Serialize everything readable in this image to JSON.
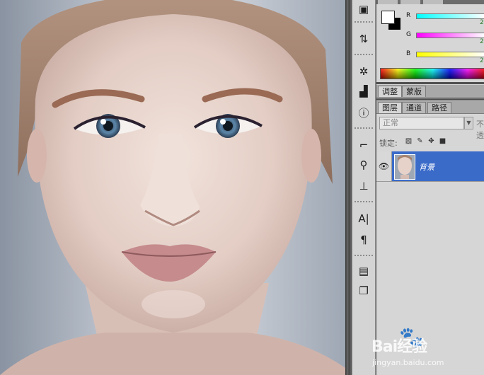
{
  "canvas": {
    "image_name": "portrait-photo"
  },
  "dock": {
    "icons": [
      "navigator-icon",
      "history-icon",
      "actions-icon",
      "histogram-icon",
      "info-icon",
      "brushes-icon",
      "clone-source-icon",
      "tool-presets-icon",
      "character-icon",
      "paragraph-icon",
      "notes-icon",
      "layer-comps-icon"
    ]
  },
  "color_panel": {
    "channels": [
      {
        "label": "R",
        "value": "2"
      },
      {
        "label": "G",
        "value": "2"
      },
      {
        "label": "B",
        "value": "2"
      }
    ],
    "foreground": "#ffffff",
    "background": "#000000"
  },
  "adjust_tabs": [
    {
      "label": "调整",
      "active": true
    },
    {
      "label": "蒙版",
      "active": false
    }
  ],
  "layers_tabs": [
    {
      "label": "图层",
      "active": true
    },
    {
      "label": "通道",
      "active": false
    },
    {
      "label": "路径",
      "active": false
    }
  ],
  "layers_panel": {
    "blend_mode": "正常",
    "opacity_label": "不透",
    "lock_label": "锁定:",
    "layers": [
      {
        "name": "背景",
        "visible": true,
        "selected": true
      }
    ]
  },
  "watermark": {
    "text": "Bai经验",
    "url": "jingyan.baidu.com"
  }
}
